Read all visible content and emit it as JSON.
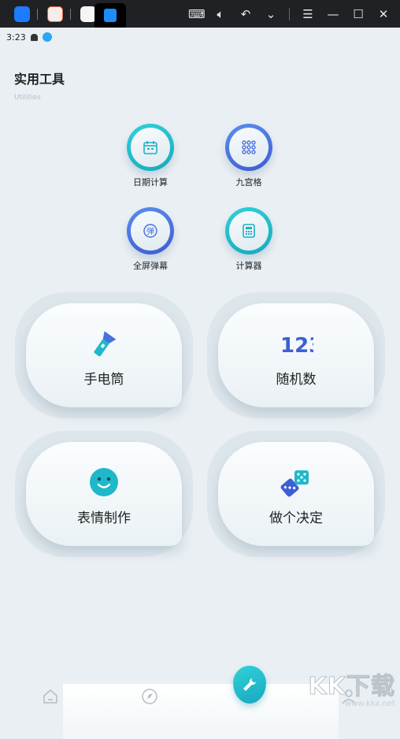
{
  "status": {
    "time": "3:23"
  },
  "header": {
    "title": "实用工具",
    "subtitle": "Utilities"
  },
  "round_tools": [
    {
      "label": "日期计算",
      "icon": "calendar-icon",
      "color": "teal"
    },
    {
      "label": "九宫格",
      "icon": "grid-icon",
      "color": "blue"
    },
    {
      "label": "全屏弹幕",
      "icon": "danmaku-icon",
      "icon_text": "弹",
      "color": "blue"
    },
    {
      "label": "计算器",
      "icon": "calculator-icon",
      "color": "teal"
    }
  ],
  "cards": [
    {
      "label": "手电筒",
      "icon": "flashlight-icon"
    },
    {
      "label": "随机数",
      "icon": "numbers-123-icon",
      "icon_text": "123"
    },
    {
      "label": "表情制作",
      "icon": "smiley-icon"
    },
    {
      "label": "做个决定",
      "icon": "dice-icon"
    }
  ],
  "bottom_nav": [
    "home-icon",
    "compass-icon",
    "tools-icon",
    "profile-icon"
  ],
  "watermark": {
    "main": "KK下载",
    "sub": "www.kkx.net"
  },
  "colors": {
    "teal": "#1fb8c9",
    "blue": "#4a6fe0",
    "background": "#e9eff3",
    "topbar": "#1f2124"
  }
}
